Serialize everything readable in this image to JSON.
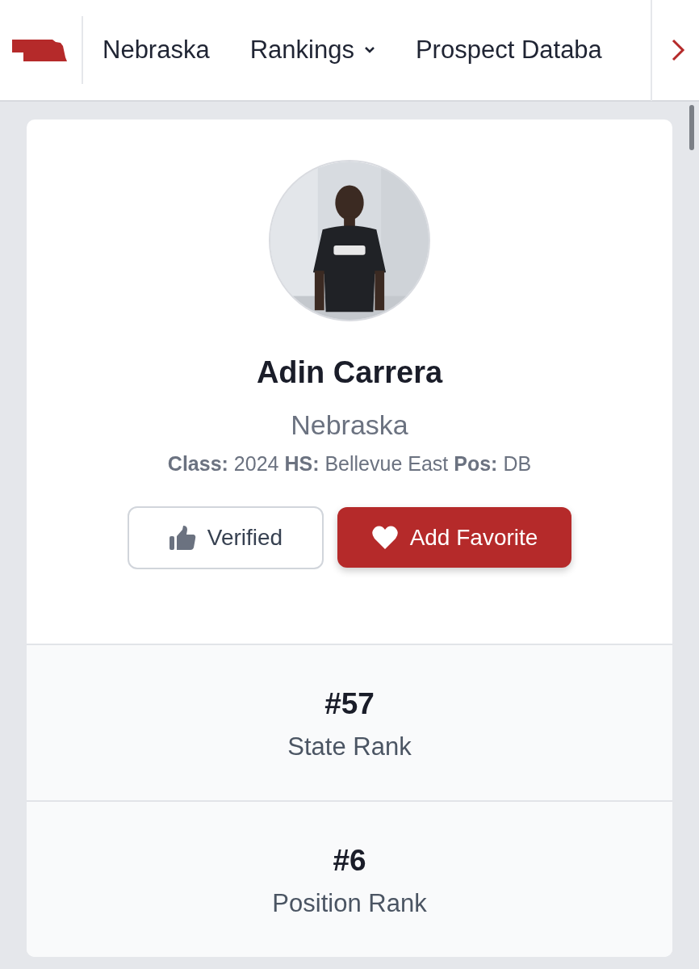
{
  "header": {
    "nav": [
      {
        "kind": "link",
        "label": "Nebraska"
      },
      {
        "kind": "dropdown",
        "label": "Rankings"
      },
      {
        "kind": "link",
        "label": "Prospect Databa"
      }
    ]
  },
  "profile": {
    "name": "Adin Carrera",
    "state": "Nebraska",
    "details": "**Class:** 2024 **HS:** Bellevue East **Pos:** DB",
    "buttons": [
      {
        "kind": "verify",
        "label": "Verified"
      },
      {
        "kind": "favorite",
        "label": "Add Favorite"
      }
    ]
  },
  "stats": [
    {
      "value": "#57",
      "label": "State Rank"
    },
    {
      "value": "#6",
      "label": "Position Rank"
    }
  ]
}
